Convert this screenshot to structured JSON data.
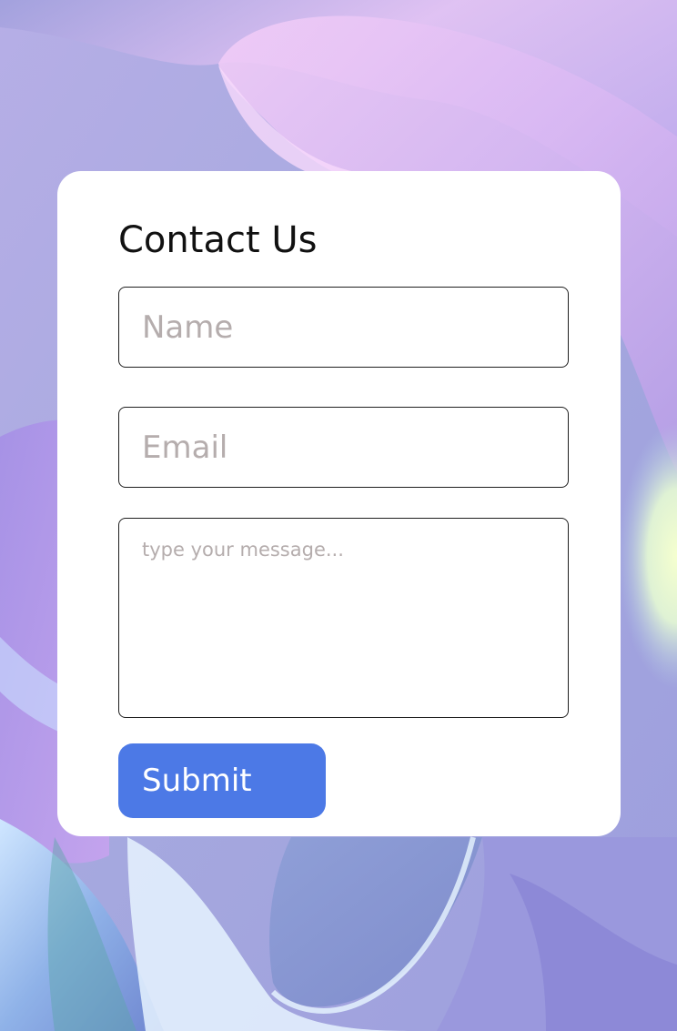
{
  "form": {
    "title": "Contact Us",
    "name_placeholder": "Name",
    "email_placeholder": "Email",
    "message_placeholder": "type your message...",
    "submit_label": "Submit"
  },
  "colors": {
    "submit_button": "#4c79e6",
    "card_background": "#ffffff",
    "placeholder_text": "#b5adad",
    "field_border": "#1f1f1f"
  }
}
